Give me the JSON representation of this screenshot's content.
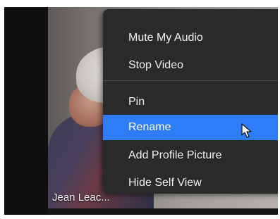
{
  "participant": {
    "name": "Jean Leac..."
  },
  "context_menu": {
    "items": [
      {
        "label": "Mute My Audio",
        "state": "normal"
      },
      {
        "label": "Stop Video",
        "state": "normal"
      },
      {
        "label": "Pin",
        "state": "normal"
      },
      {
        "label": "Rename",
        "state": "highlighted"
      },
      {
        "label": "Add Profile Picture",
        "state": "normal"
      },
      {
        "label": "Hide Self View",
        "state": "normal"
      }
    ]
  },
  "colors": {
    "menu_background": "#2a2a2a",
    "highlight": "#2f7df6",
    "text": "#f0f0f0"
  },
  "icons": {
    "pointer": "mouse-pointer-icon"
  }
}
